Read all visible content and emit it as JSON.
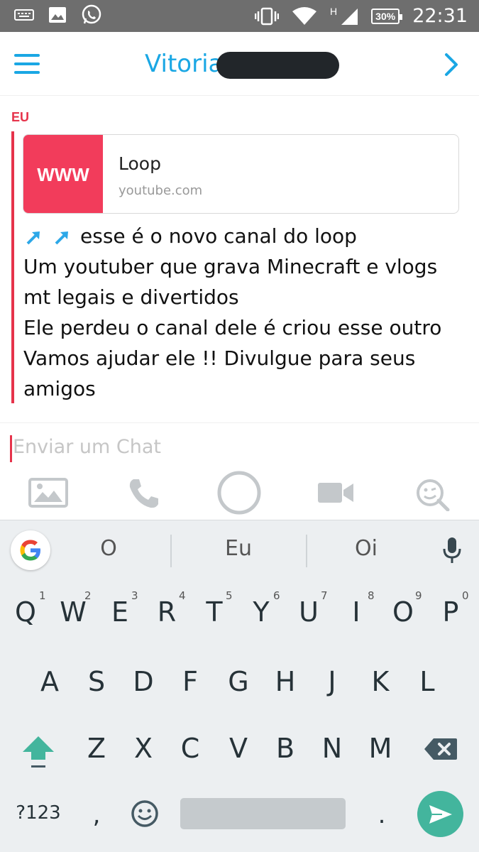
{
  "status_bar": {
    "time": "22:31",
    "battery": "30%",
    "network": "H",
    "icons": [
      "keyboard-icon",
      "image-icon",
      "whatsapp-icon",
      "vibrate-icon",
      "wifi-icon",
      "signal-icon",
      "battery-icon"
    ]
  },
  "header": {
    "title": "Vitoria",
    "menu_icon": "hamburger-menu-icon",
    "forward_icon": "chevron-right-icon"
  },
  "chat": {
    "sender": "EU",
    "link": {
      "thumb": "WWW",
      "title": "Loop",
      "domain": "youtube.com"
    },
    "lines": [
      "esse é o novo canal do loop",
      "Um youtuber que grava Minecraft e vlogs mt legais e divertidos",
      "Ele perdeu o canal dele é criou esse outro",
      "Vamos ajudar ele !! Divulgue para seus amigos"
    ]
  },
  "input": {
    "placeholder": "Enviar um Chat"
  },
  "actions": [
    "gallery-icon",
    "phone-icon",
    "capture-icon",
    "video-icon",
    "sticker-icon"
  ],
  "suggestions": [
    "O",
    "Eu",
    "Oi"
  ],
  "keyboard": {
    "row1": [
      "Q",
      "W",
      "E",
      "R",
      "T",
      "Y",
      "U",
      "I",
      "O",
      "P"
    ],
    "row1_hints": [
      "1",
      "2",
      "3",
      "4",
      "5",
      "6",
      "7",
      "8",
      "9",
      "0"
    ],
    "row2": [
      "A",
      "S",
      "D",
      "F",
      "G",
      "H",
      "J",
      "K",
      "L"
    ],
    "row3": [
      "Z",
      "X",
      "C",
      "V",
      "B",
      "N",
      "M"
    ],
    "symbols": "?123",
    "comma": ",",
    "period": "."
  },
  "colors": {
    "accent_blue": "#1aa7e4",
    "snap_red": "#e6334b",
    "link_thumb": "#f23c5b",
    "enter_green": "#43b59d"
  }
}
